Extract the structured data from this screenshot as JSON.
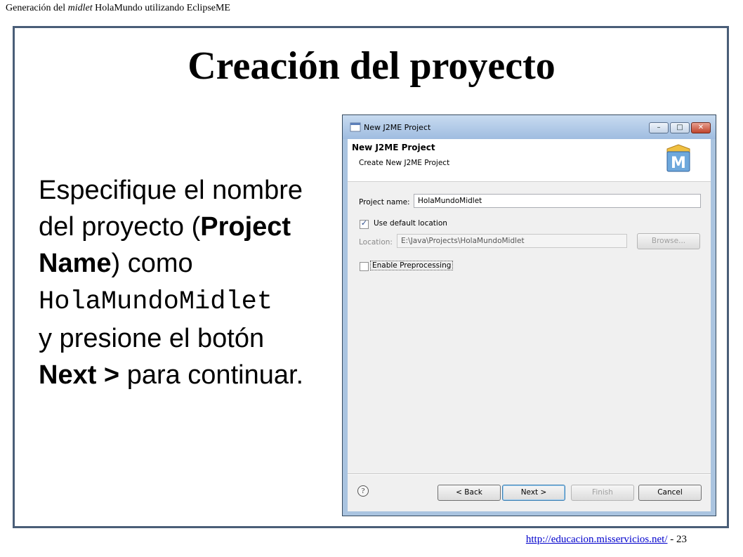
{
  "header": {
    "prefix": "Generación del",
    "italic": "midlet",
    "suffix": "HolaMundo utilizando EclipseME"
  },
  "slide": {
    "title": "Creación del proyecto",
    "text": {
      "p1": "Especifique el nombre del proyecto (",
      "b1": "Project Name",
      "p2": ") como",
      "mono": "HolaMundoMidlet",
      "p3": "y presione el botón",
      "b2": "Next >",
      "p4": "para continuar."
    }
  },
  "footer": {
    "link": "http://educacion.misservicios.net/",
    "page": "- 23"
  },
  "dialog": {
    "window_title": "New J2ME Project",
    "banner_title": "New J2ME Project",
    "banner_subtitle": "Create New J2ME Project",
    "logo_letter": "M",
    "project_name_label": "Project name:",
    "project_name_value": "HolaMundoMidlet",
    "use_default_label": "Use default location",
    "use_default_checked": true,
    "location_label": "Location:",
    "location_value": "E:\\Java\\Projects\\HolaMundoMidlet",
    "browse_label": "Browse...",
    "preprocessing_label": "Enable Preprocessing",
    "preprocessing_checked": false,
    "help_glyph": "?",
    "buttons": {
      "back": "< Back",
      "next": "Next >",
      "finish": "Finish",
      "cancel": "Cancel"
    },
    "window_controls": {
      "minimize": "–",
      "maximize": "□",
      "close": "✕"
    }
  },
  "colors": {
    "frame_border": "#4a5e78",
    "dialog_border": "#aac4e0",
    "link": "#0000cc"
  }
}
